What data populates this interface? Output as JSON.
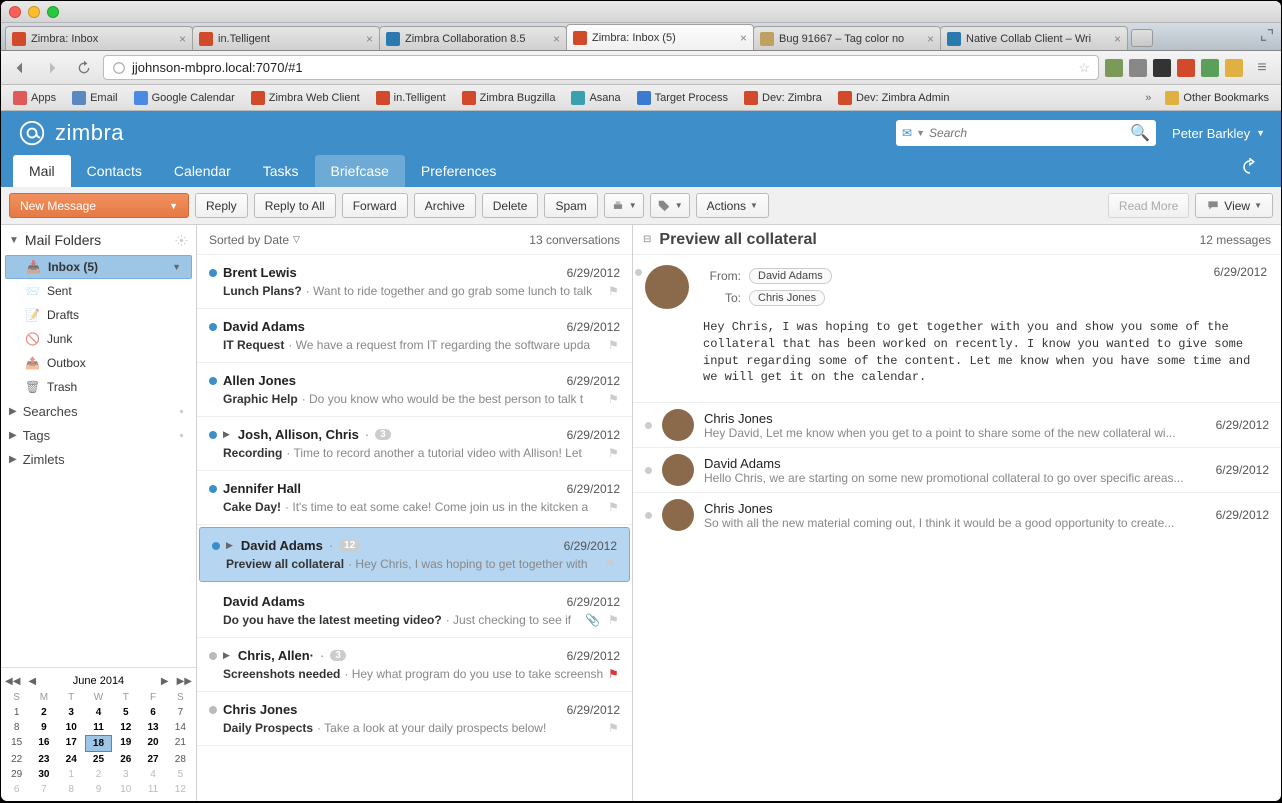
{
  "browser": {
    "tabs": [
      {
        "title": "Zimbra: Inbox",
        "icon": "#d04a2b"
      },
      {
        "title": "in.Telligent",
        "icon": "#d04a2b"
      },
      {
        "title": "Zimbra Collaboration 8.5",
        "icon": "#2a7ab0"
      },
      {
        "title": "Zimbra: Inbox (5)",
        "icon": "#d04a2b",
        "active": true
      },
      {
        "title": "Bug 91667 – Tag color no",
        "icon": "#c0a060"
      },
      {
        "title": "Native Collab Client – Wri",
        "icon": "#2a7ab0"
      }
    ],
    "url": "jjohnson-mbpro.local:7070/#1",
    "bookmarks": [
      "Apps",
      "Email",
      "Google Calendar",
      "Zimbra Web Client",
      "in.Telligent",
      "Zimbra Bugzilla",
      "Asana",
      "Target Process",
      "Dev: Zimbra",
      "Dev: Zimbra Admin"
    ],
    "other_bookmarks": "Other Bookmarks"
  },
  "app": {
    "brand": "zimbra",
    "search_placeholder": "Search",
    "user": "Peter Barkley",
    "nav": [
      "Mail",
      "Contacts",
      "Calendar",
      "Tasks",
      "Briefcase",
      "Preferences"
    ],
    "nav_selected": 0,
    "nav_highlight": 4
  },
  "toolbar": {
    "new_message": "New Message",
    "buttons": [
      "Reply",
      "Reply to All",
      "Forward",
      "Archive",
      "Delete",
      "Spam"
    ],
    "actions": "Actions",
    "read_more": "Read More",
    "view": "View"
  },
  "folders": {
    "header": "Mail Folders",
    "items": [
      {
        "name": "Inbox (5)",
        "sel": true,
        "icon": "inbox"
      },
      {
        "name": "Sent",
        "icon": "sent"
      },
      {
        "name": "Drafts",
        "icon": "drafts"
      },
      {
        "name": "Junk",
        "icon": "junk"
      },
      {
        "name": "Outbox",
        "icon": "outbox"
      },
      {
        "name": "Trash",
        "icon": "trash"
      }
    ],
    "sections": [
      "Searches",
      "Tags",
      "Zimlets"
    ]
  },
  "calendar": {
    "title": "June 2014",
    "dow": [
      "S",
      "M",
      "T",
      "W",
      "T",
      "F",
      "S"
    ],
    "weeks": [
      [
        {
          "d": 1
        },
        {
          "d": 2,
          "b": 1
        },
        {
          "d": 3,
          "b": 1
        },
        {
          "d": 4,
          "b": 1
        },
        {
          "d": 5,
          "b": 1
        },
        {
          "d": 6,
          "b": 1
        },
        {
          "d": 7
        }
      ],
      [
        {
          "d": 8
        },
        {
          "d": 9,
          "b": 1
        },
        {
          "d": 10,
          "b": 1
        },
        {
          "d": 11,
          "b": 1
        },
        {
          "d": 12,
          "b": 1
        },
        {
          "d": 13,
          "b": 1
        },
        {
          "d": 14
        }
      ],
      [
        {
          "d": 15
        },
        {
          "d": 16,
          "b": 1
        },
        {
          "d": 17,
          "b": 1
        },
        {
          "d": 18,
          "b": 1,
          "t": 1
        },
        {
          "d": 19,
          "b": 1
        },
        {
          "d": 20,
          "b": 1
        },
        {
          "d": 21
        }
      ],
      [
        {
          "d": 22
        },
        {
          "d": 23,
          "b": 1
        },
        {
          "d": 24,
          "b": 1
        },
        {
          "d": 25,
          "b": 1
        },
        {
          "d": 26,
          "b": 1
        },
        {
          "d": 27,
          "b": 1
        },
        {
          "d": 28
        }
      ],
      [
        {
          "d": 29
        },
        {
          "d": 30,
          "b": 1
        },
        {
          "d": 1,
          "g": 1
        },
        {
          "d": 2,
          "g": 1
        },
        {
          "d": 3,
          "g": 1
        },
        {
          "d": 4,
          "g": 1
        },
        {
          "d": 5,
          "g": 1
        }
      ],
      [
        {
          "d": 6,
          "g": 1
        },
        {
          "d": 7,
          "g": 1
        },
        {
          "d": 8,
          "g": 1
        },
        {
          "d": 9,
          "g": 1
        },
        {
          "d": 10,
          "g": 1
        },
        {
          "d": 11,
          "g": 1
        },
        {
          "d": 12,
          "g": 1
        }
      ]
    ]
  },
  "convlist": {
    "sort": "Sorted by Date",
    "count": "13 conversations",
    "items": [
      {
        "unread": true,
        "sender": "Brent Lewis",
        "date": "6/29/2012",
        "subject": "Lunch Plans?",
        "snip": "· Want to ride together and go grab some lunch to talk"
      },
      {
        "unread": true,
        "sender": "David Adams",
        "date": "6/29/2012",
        "subject": "IT Request",
        "snip": "· We have a request from IT regarding the software upda"
      },
      {
        "unread": true,
        "sender": "Allen Jones",
        "date": "6/29/2012",
        "subject": "Graphic Help",
        "snip": "· Do you know who would be the best person to talk t"
      },
      {
        "unread": true,
        "exp": true,
        "sender": "Josh, Allison, Chris",
        "badge": "3",
        "date": "6/29/2012",
        "subject": "Recording",
        "snip": "· Time to record another a tutorial video with Allison! Let"
      },
      {
        "unread": true,
        "sender": "Jennifer Hall",
        "date": "6/29/2012",
        "subject": "Cake Day!",
        "snip": "· It's time to eat some cake! Come join us in the kitcken a"
      },
      {
        "sel": true,
        "exp": true,
        "sender": "David Adams",
        "badge": "12",
        "date": "6/29/2012",
        "subject": "Preview all collateral",
        "snip": "· Hey Chris, I was hoping to get together with"
      },
      {
        "sender": "David Adams",
        "date": "6/29/2012",
        "subject": "Do you have the latest meeting video?",
        "snip": "· Just checking to see if",
        "att": true
      },
      {
        "gr": true,
        "exp": true,
        "sender": "Chris, Allen·",
        "badge": "3",
        "date": "6/29/2012",
        "subject": "Screenshots needed",
        "snip": "· Hey what program do you use to take screensh",
        "flag": true
      },
      {
        "gr": true,
        "sender": "Chris Jones",
        "date": "6/29/2012",
        "subject": "Daily Prospects",
        "snip": "· Take a look at your daily prospects below!"
      }
    ]
  },
  "preview": {
    "title": "Preview all collateral",
    "count": "12 messages",
    "from_label": "From:",
    "to_label": "To:",
    "from": "David Adams",
    "to": "Chris Jones",
    "date": "6/29/2012",
    "body": "Hey Chris, I was hoping to get together with you and show you some of the collateral that has been worked on recently. I know you wanted to give some input regarding some of the content. Let me know when you have some time and we will get it on the calendar.",
    "thread": [
      {
        "name": "Chris Jones",
        "date": "6/29/2012",
        "snip": "Hey David, Let me know when you get to a point to share some of the new collateral wi..."
      },
      {
        "name": "David Adams",
        "date": "6/29/2012",
        "snip": "Hello Chris, we are starting on some new promotional collateral to go over specific areas..."
      },
      {
        "name": "Chris Jones",
        "date": "6/29/2012",
        "snip": "So with all the new material coming out, I think it would be a good opportunity to create..."
      }
    ]
  }
}
